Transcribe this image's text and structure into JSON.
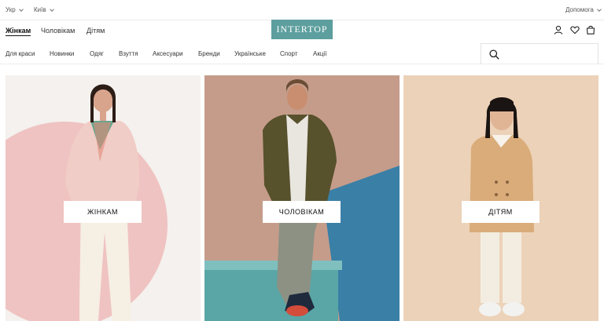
{
  "topbar": {
    "language": "Укр",
    "city": "Київ",
    "help": "Допомога"
  },
  "header": {
    "tabs": [
      {
        "label": "Жінкам",
        "active": true
      },
      {
        "label": "Чоловікам",
        "active": false
      },
      {
        "label": "Дітям",
        "active": false
      }
    ],
    "logo": "INTERTOP",
    "brand_color": "#5d9f9e",
    "icons": [
      "user-icon",
      "heart-icon",
      "bag-icon"
    ]
  },
  "nav": {
    "items": [
      "Для краси",
      "Новинки",
      "Одяг",
      "Взуття",
      "Аксесуари",
      "Бренди",
      "Українське",
      "Спорт",
      "Акції"
    ],
    "search_placeholder": ""
  },
  "tiles": [
    {
      "label": "ЖІНКАМ",
      "bg": "#f4f1ee",
      "accent": "#efc3c1"
    },
    {
      "label": "ЧОЛОВІКАМ",
      "bg": "#c59c8a",
      "accent": "#3a7fa6"
    },
    {
      "label": "ДІТЯМ",
      "bg": "#ecd2b8",
      "accent": "#d9ac7a"
    }
  ]
}
